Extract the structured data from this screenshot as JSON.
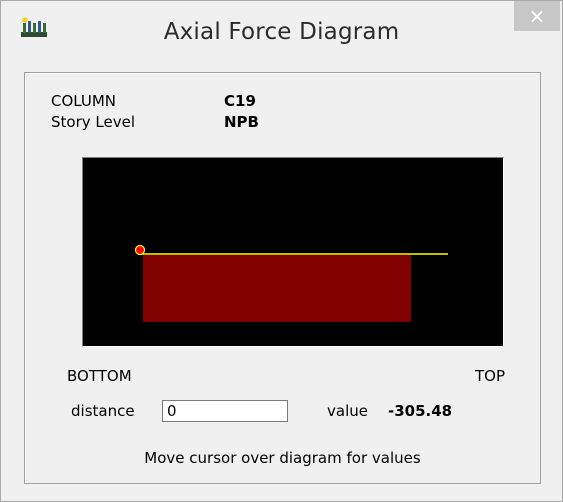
{
  "window": {
    "title": "Axial Force Diagram",
    "close_symbol": "×",
    "app_icon": "columns-app-icon"
  },
  "info": {
    "column_label": "COLUMN",
    "column_value": "C19",
    "story_label": "Story Level",
    "story_value": "NPB"
  },
  "diagram": {
    "background_color": "#000000",
    "force_fill_color": "#800000",
    "axis_line_color": "#ffff00",
    "cursor_marker_color": "#ff0000",
    "bottom_label": "BOTTOM",
    "top_label": "TOP"
  },
  "readout": {
    "distance_label": "distance",
    "distance_value": "0",
    "value_label": "value",
    "value": "-305.48"
  },
  "hint": "Move cursor over diagram for values"
}
